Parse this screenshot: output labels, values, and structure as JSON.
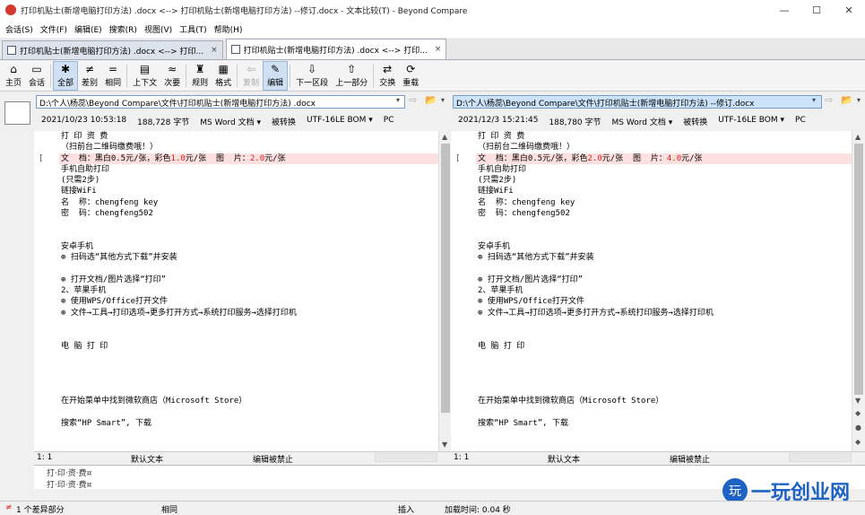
{
  "window": {
    "title": "打印机贴士(新增电脑打印方法) .docx <--> 打印机贴士(新增电脑打印方法) --修订.docx - 文本比较(T) - Beyond Compare",
    "minimize": "—",
    "maximize": "☐",
    "close": "✕"
  },
  "menu": [
    "会话(S)",
    "文件(F)",
    "编辑(E)",
    "搜索(R)",
    "视图(V)",
    "工具(T)",
    "帮助(H)"
  ],
  "tabs": [
    {
      "label": "打印机贴士(新增电脑打印方法) .docx <--> 打印...",
      "close": "×"
    },
    {
      "label": "打印机贴士(新增电脑打印方法) .docx <--> 打印...",
      "close": "×"
    }
  ],
  "toolbar": [
    {
      "label": "主页",
      "icon": "⌂",
      "name": "home"
    },
    {
      "label": "会话",
      "icon": "▭",
      "name": "session"
    },
    {
      "label": "全部",
      "icon": "✱",
      "name": "all"
    },
    {
      "label": "差别",
      "icon": "≠",
      "name": "diffs"
    },
    {
      "label": "相同",
      "icon": "=",
      "name": "same"
    },
    {
      "label": "上下文",
      "icon": "▤",
      "name": "context"
    },
    {
      "label": "次要",
      "icon": "≈",
      "name": "minor"
    },
    {
      "label": "规则",
      "icon": "♜",
      "name": "rules"
    },
    {
      "label": "格式",
      "icon": "▦",
      "name": "format"
    },
    {
      "label": "复制",
      "icon": "⇦",
      "name": "copy"
    },
    {
      "label": "编辑",
      "icon": "✎",
      "name": "edit"
    },
    {
      "label": "下一区段",
      "icon": "⇩",
      "name": "next-section"
    },
    {
      "label": "上一部分",
      "icon": "⇧",
      "name": "prev-section"
    },
    {
      "label": "交换",
      "icon": "⇄",
      "name": "swap"
    },
    {
      "label": "重载",
      "icon": "⟳",
      "name": "reload"
    }
  ],
  "left": {
    "path": "D:\\个人\\杨蕊\\Beyond Compare\\文件\\打印机贴士(新增电脑打印方法) .docx",
    "date": "2021/10/23 10:53:18",
    "size": "188,728 字节",
    "format": "MS Word 文档 ▾",
    "conv": "被转换",
    "enc": "UTF-16LE BOM ▾",
    "eol": "PC",
    "pos": "1: 1",
    "mode": "默认文本",
    "edit": "编辑被禁止"
  },
  "right": {
    "path": "D:\\个人\\杨蕊\\Beyond Compare\\文件\\打印机贴士(新增电脑打印方法) --修订.docx",
    "date": "2021/12/3 15:21:45",
    "size": "188,780 字节",
    "format": "MS Word 文档 ▾",
    "conv": "被转换",
    "enc": "UTF-16LE BOM ▾",
    "eol": "PC",
    "pos": "1: 1",
    "mode": "默认文本",
    "edit": "编辑被禁止"
  },
  "lines_common": [
    "打 印 资 费",
    "（扫前台二维码缴费哦！）",
    "",
    "手机自助打印",
    "(只需2步)",
    "链接WiFi",
    "名  称：chengfeng key",
    "密  码：chengfeng502",
    "",
    "",
    "安卓手机",
    "⊕ 扫码选“其他方式下载”并安装",
    "",
    "⊕ 打开文档/图片选择“打印”",
    "2、苹果手机",
    "⊕ 使用WPS/Office打开文件",
    "⊕ 文件→工具→打印选项→更多打开方式→系统打印服务→选择打印机",
    "",
    "",
    "电 脑 打 印",
    "",
    "",
    "",
    "",
    "在开始菜单中找到微软商店（Microsoft Store）",
    "",
    "搜索“HP Smart”, 下载"
  ],
  "left_diff": {
    "a": "文  档：黑白0.5元/张，彩色",
    "b": "1.0",
    "c": "元/张  图  片：",
    "d": "2.0",
    "e": "元/张"
  },
  "right_diff": {
    "a": "文  档：黑白0.5元/张，彩色",
    "b": "2.0",
    "c": "元/张  图  片：",
    "d": "4.0",
    "e": "元/张"
  },
  "gutter_mark": "[",
  "bottom": {
    "line1": "打·印·资·费¤",
    "line2": "打·印·资·费¤"
  },
  "status": {
    "count": "1 个差异部分",
    "same": "相同",
    "insert": "插入",
    "load": "加载时间: 0.04 秒"
  },
  "watermark": {
    "logo": "玩",
    "text": "一玩创业网"
  }
}
